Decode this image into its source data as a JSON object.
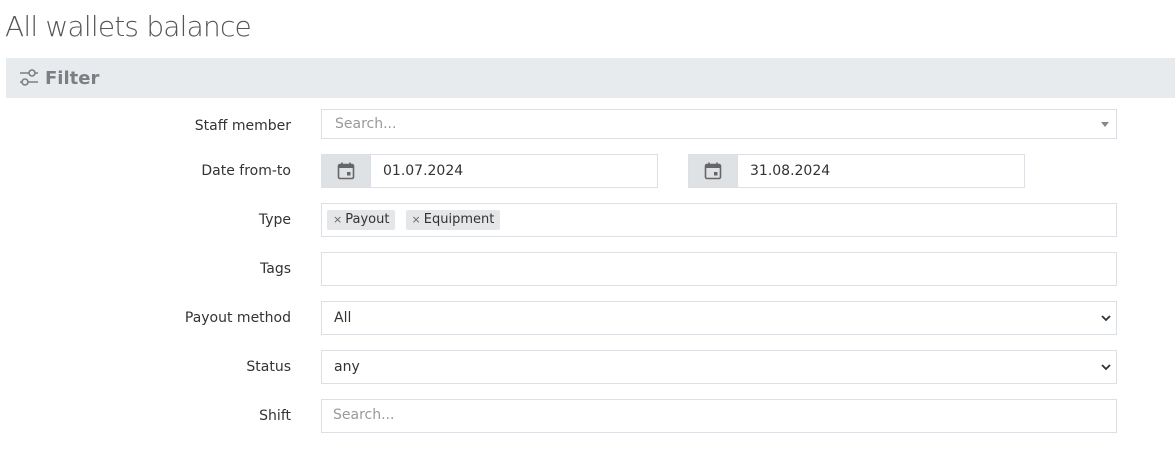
{
  "page": {
    "title": "All wallets balance"
  },
  "filter": {
    "title": "Filter",
    "icon": "sliders-icon",
    "fields": {
      "staff_member": {
        "label": "Staff member",
        "placeholder": "Search..."
      },
      "date_range": {
        "label": "Date from-to",
        "from": "01.07.2024",
        "to": "31.08.2024",
        "icon": "calendar-icon"
      },
      "type": {
        "label": "Type",
        "tags": [
          "Payout",
          "Equipment"
        ],
        "remove_glyph": "×"
      },
      "tags": {
        "label": "Tags",
        "value": ""
      },
      "payout_method": {
        "label": "Payout method",
        "value": "All"
      },
      "status": {
        "label": "Status",
        "value": "any"
      },
      "shift": {
        "label": "Shift",
        "placeholder": "Search..."
      }
    }
  },
  "colors": {
    "header_bg": "#e8ebed",
    "addon_bg": "#dfe2e5",
    "border": "#dcdfe3",
    "tag_bg": "#e4e6e8"
  }
}
